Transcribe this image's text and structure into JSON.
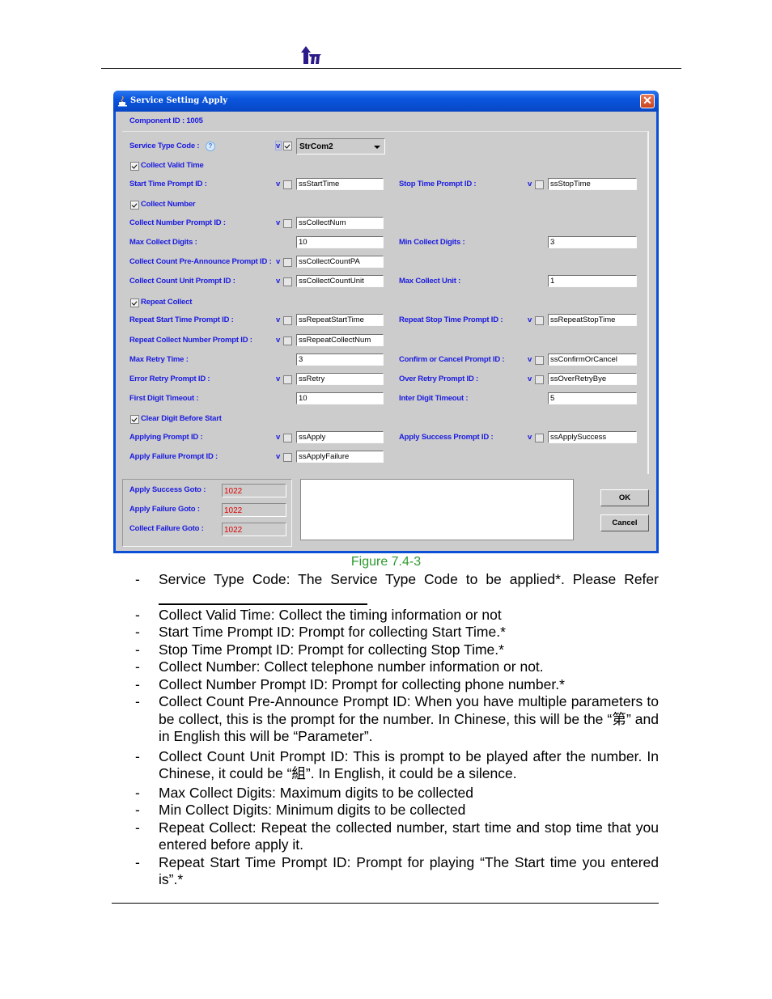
{
  "page": {
    "logo_icon": "company-arrow-logo-icon",
    "figure_caption": "Figure 7.4-3"
  },
  "dialog": {
    "title": "Service Setting Apply",
    "title_icon": "java-cup-icon",
    "close_icon": "close-icon",
    "close_glyph": "✕",
    "component_id_label": "Component ID : 1005",
    "v_marker": "v",
    "help_glyph": "?",
    "service_type_code": {
      "label": "Service Type Code :",
      "v_checked": true,
      "value": "StrCom2"
    },
    "collect_valid_time": {
      "label": "Collect Valid Time",
      "checked": true
    },
    "start_time_prompt": {
      "label": "Start Time Prompt ID :",
      "v_checked": false,
      "value": "ssStartTime"
    },
    "stop_time_prompt": {
      "label": "Stop Time Prompt ID :",
      "v_checked": false,
      "value": "ssStopTime"
    },
    "collect_number": {
      "label": "Collect Number",
      "checked": true
    },
    "collect_number_prompt": {
      "label": "Collect Number Prompt ID :",
      "v_checked": false,
      "value": "ssCollectNum"
    },
    "max_collect_digits": {
      "label": "Max Collect Digits :",
      "value": "10"
    },
    "min_collect_digits": {
      "label": "Min Collect Digits :",
      "value": "3"
    },
    "collect_count_pa_prompt": {
      "label": "Collect Count Pre-Announce Prompt ID :",
      "v_checked": false,
      "value": "ssCollectCountPA"
    },
    "collect_count_unit_prompt": {
      "label": "Collect Count Unit Prompt ID :",
      "v_checked": false,
      "value": "ssCollectCountUnit"
    },
    "max_collect_unit": {
      "label": "Max Collect Unit :",
      "value": "1"
    },
    "repeat_collect": {
      "label": "Repeat Collect",
      "checked": true
    },
    "repeat_start_time_prompt": {
      "label": "Repeat Start Time Prompt ID :",
      "v_checked": false,
      "value": "ssRepeatStartTime"
    },
    "repeat_stop_time_prompt": {
      "label": "Repeat Stop Time Prompt ID :",
      "v_checked": false,
      "value": "ssRepeatStopTime"
    },
    "repeat_collect_number_prompt": {
      "label": "Repeat Collect Number Prompt ID :",
      "v_checked": false,
      "value": "ssRepeatCollectNum"
    },
    "max_retry_time": {
      "label": "Max Retry Time :",
      "value": "3"
    },
    "confirm_cancel_prompt": {
      "label": "Confirm or Cancel Prompt ID :",
      "v_checked": false,
      "value": "ssConfirmOrCancel"
    },
    "error_retry_prompt": {
      "label": "Error Retry Prompt ID :",
      "v_checked": false,
      "value": "ssRetry"
    },
    "over_retry_prompt": {
      "label": "Over Retry Prompt ID :",
      "v_checked": false,
      "value": "ssOverRetryBye"
    },
    "first_digit_timeout": {
      "label": "First Digit Timeout :",
      "value": "10"
    },
    "inter_digit_timeout": {
      "label": "Inter Digit Timeout :",
      "value": "5"
    },
    "clear_digit_before_start": {
      "label": "Clear Digit Before Start",
      "checked": true
    },
    "applying_prompt": {
      "label": "Applying Prompt ID :",
      "v_checked": false,
      "value": "ssApply"
    },
    "apply_success_prompt": {
      "label": "Apply Success Prompt ID :",
      "v_checked": false,
      "value": "ssApplySuccess"
    },
    "apply_failure_prompt": {
      "label": "Apply Failure Prompt ID :",
      "v_checked": false,
      "value": "ssApplyFailure"
    },
    "apply_success_goto": {
      "label": "Apply Success Goto :",
      "value": "1022"
    },
    "apply_failure_goto": {
      "label": "Apply Failure Goto :",
      "value": "1022"
    },
    "collect_failure_goto": {
      "label": "Collect Failure Goto :",
      "value": "1022"
    },
    "message_area": "",
    "ok_label": "OK",
    "cancel_label": "Cancel"
  },
  "descriptions": [
    {
      "dash": "-",
      "text": "Service Type Code: The Service Type Code to be applied*. Please Refer"
    },
    {
      "dash": "-",
      "text": "Collect Valid Time: Collect the timing information or not"
    },
    {
      "dash": "-",
      "text": "Start Time Prompt ID: Prompt for collecting Start Time.*"
    },
    {
      "dash": "-",
      "text": "Stop Time Prompt ID: Prompt for collecting Stop Time.*"
    },
    {
      "dash": "-",
      "text": "Collect Number: Collect telephone number information or not."
    },
    {
      "dash": "-",
      "text": "Collect Number Prompt ID: Prompt for collecting phone number.*"
    },
    {
      "dash": "-",
      "text": "Collect Count Pre-Announce Prompt ID: When you have multiple parameters to be collect, this is the prompt for the number. In Chinese, this will be the “第” and in English this will be “Parameter”."
    },
    {
      "dash": "-",
      "text": "Collect Count Unit Prompt ID: This is prompt to be played after the number. In Chinese, it could be “組”. In English, it could be a silence."
    },
    {
      "dash": "-",
      "text": "Max Collect Digits: Maximum digits to be collected"
    },
    {
      "dash": "-",
      "text": "Min Collect Digits: Minimum digits to be collected"
    },
    {
      "dash": "-",
      "text": "Repeat Collect: Repeat the collected number, start time and stop time that you entered before apply it."
    },
    {
      "dash": "-",
      "text": "Repeat Start Time Prompt ID: Prompt for playing “The Start time you entered is”.*"
    }
  ]
}
